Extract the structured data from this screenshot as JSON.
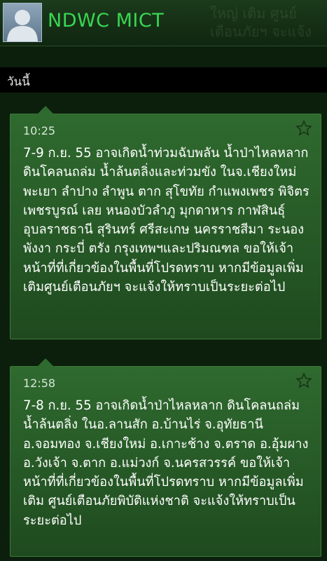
{
  "header": {
    "contact_name": "NDWC MICT",
    "ghost_text": "ใหญ่ เติม ศูนย์เตือนภัยฯ จะแจ้งให้ทราบเป็นระยะต่อไป"
  },
  "date_separator": {
    "label": "วันนี้"
  },
  "messages": [
    {
      "time": "10:25",
      "text": "7-9 ก.ย. 55 อาจเกิดน้ำท่วมฉับพลัน น้ำป่าไหลหลาก ดินโคลนถล่ม น้ำล้นตลิ่งและท่วมขัง ในจ.เชียงใหม่ พะเยา ลำปาง ลำพูน ตาก สุโขทัย กำแพงเพชร พิจิตร เพชรบูรณ์ เลย หนองบัวลำภู มุกดาหาร กาฬสินธุ์ อุบลราชธานี สุรินทร์ ศรีสะเกษ นครราชสีมา ระนอง พังงา กระบี่ ตรัง กรุงเทพฯและปริมณฑล ขอให้เจ้าหน้าที่ที่เกี่ยวข้องในพื้นที่โปรดทราบ หากมีข้อมูลเพิ่มเติมศูนย์เตือนภัยฯ จะแจ้งให้ทราบเป็นระยะต่อไป"
    },
    {
      "time": "12:58",
      "text": "7-8 ก.ย. 55 อาจเกิดน้ำป่าไหลหลาก ดินโคลนถล่ม น้ำล้นตลิ่ง ในอ.ลานสัก อ.บ้านไร่ จ.อุทัยธานี อ.จอมทอง จ.เชียงใหม่ อ.เกาะช้าง จ.ตราด อ.อุ้มผาง อ.วังเจ้า จ.ตาก อ.แม่วงก์ จ.นครสวรรค์ ขอให้เจ้าหน้าที่ที่เกี่ยวข้องในพื้นที่โปรดทราบ หากมีข้อมูลเพิ่มเติม ศูนย์เตือนภัยพิบัติแห่งชาติ จะแจ้งให้ทราบเป็นระยะต่อไป"
    }
  ],
  "colors": {
    "accent": "#39d653",
    "bubble": "#2f6a2f",
    "background": "#0c1f0c"
  },
  "icons": {
    "avatar": "default-contact-silhouette",
    "star": "star-outline-icon"
  }
}
